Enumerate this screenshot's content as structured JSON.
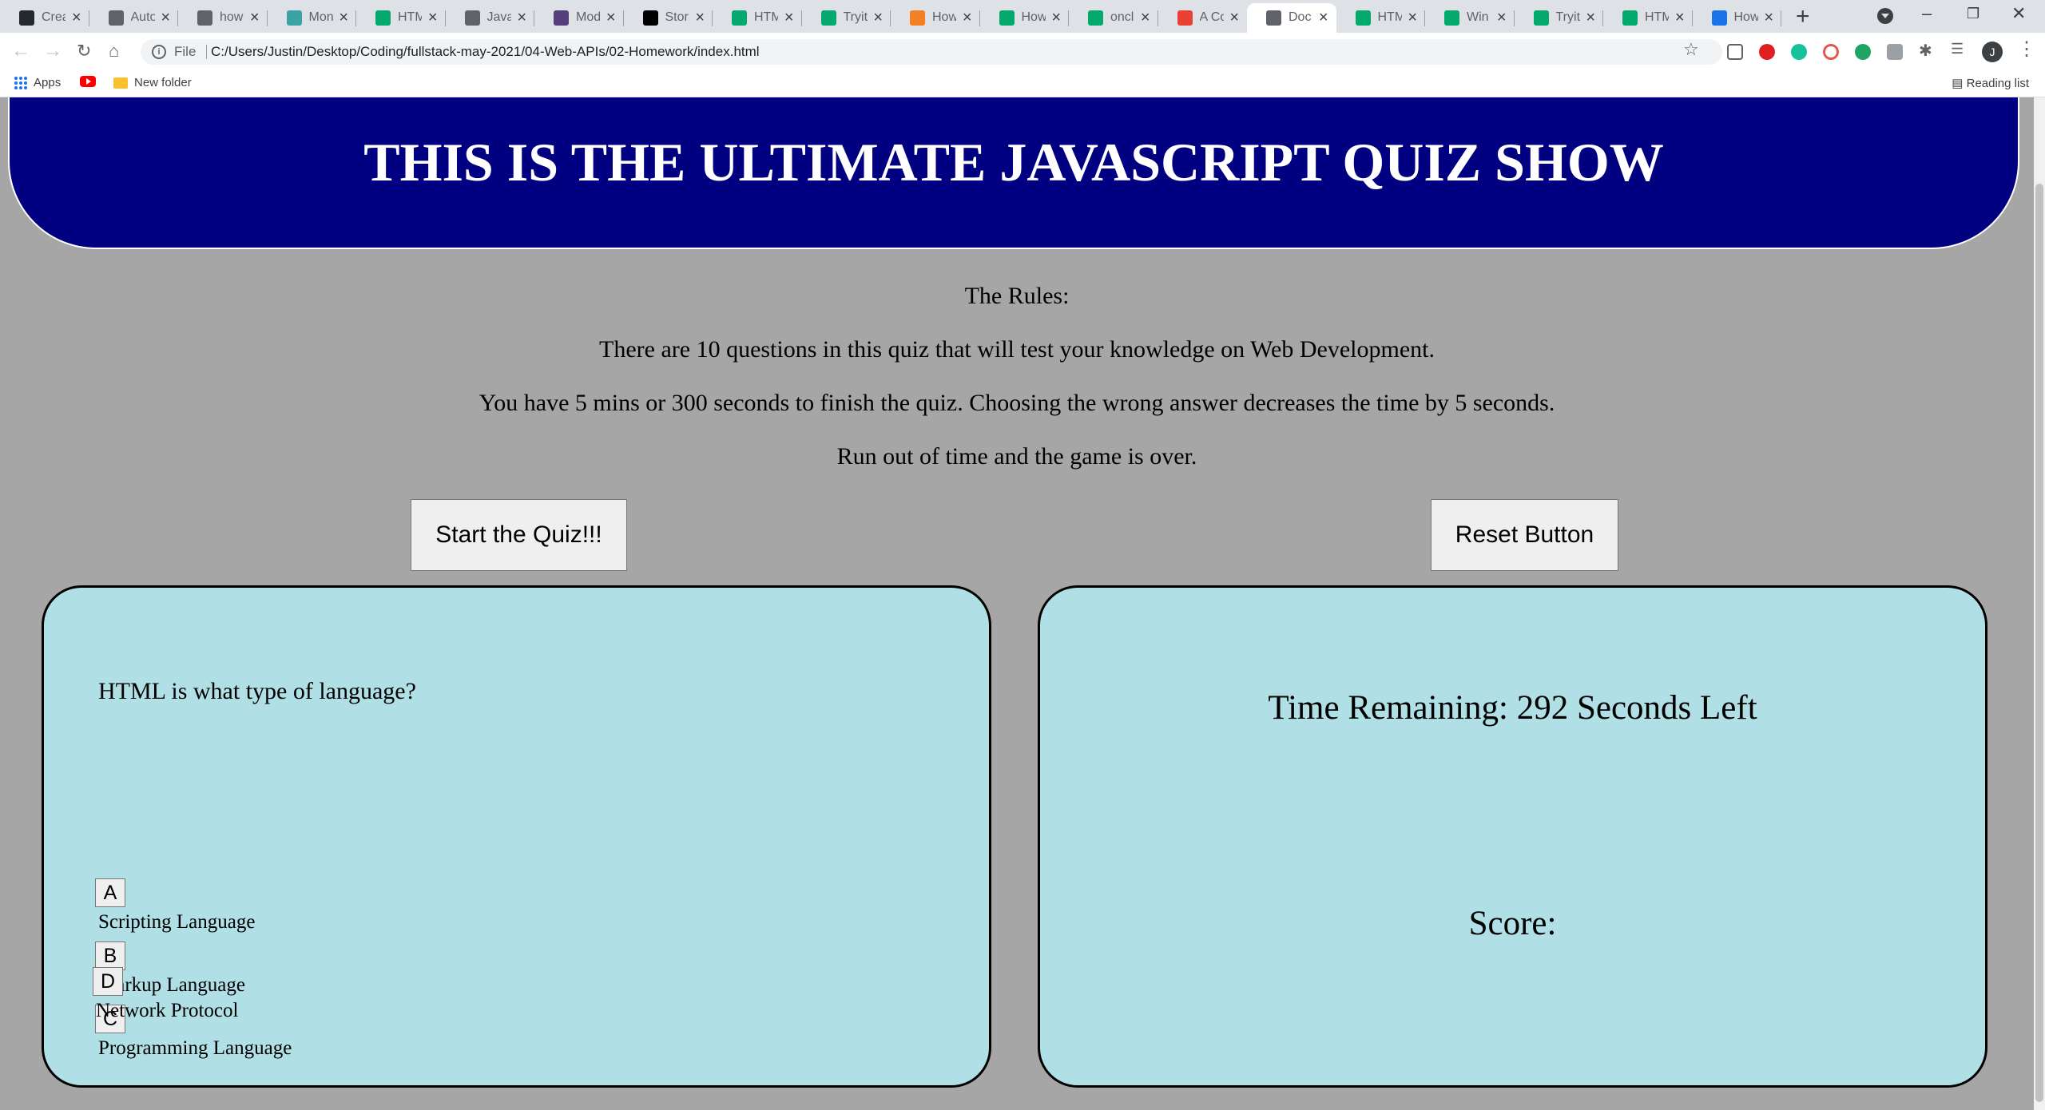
{
  "browser": {
    "tabs": [
      {
        "title": "Crea",
        "icon": "github-icon",
        "color": "#24292e"
      },
      {
        "title": "Auto",
        "icon": "globe-icon",
        "color": "#5f6368"
      },
      {
        "title": "how",
        "icon": "globe-icon",
        "color": "#5f6368"
      },
      {
        "title": "Mon",
        "icon": "clock-icon",
        "color": "#3aa3a3"
      },
      {
        "title": "HTM",
        "icon": "w3schools-icon",
        "color": "#04aa6d"
      },
      {
        "title": "Java",
        "icon": "globe-icon",
        "color": "#5f6368"
      },
      {
        "title": "Mod",
        "icon": "bootstrap-icon",
        "color": "#563d7c"
      },
      {
        "title": "Stor",
        "icon": "stackoverflow-icon",
        "color": "#000000"
      },
      {
        "title": "HTM",
        "icon": "w3schools-icon",
        "color": "#04aa6d"
      },
      {
        "title": "Tryit",
        "icon": "w3schools-icon",
        "color": "#04aa6d"
      },
      {
        "title": "How",
        "icon": "pencil-icon",
        "color": "#f48024"
      },
      {
        "title": "How",
        "icon": "w3schools-icon",
        "color": "#04aa6d"
      },
      {
        "title": "oncl",
        "icon": "w3schools-icon",
        "color": "#04aa6d"
      },
      {
        "title": "A Co",
        "icon": "asterisk-icon",
        "color": "#e94235"
      },
      {
        "title": "Doc",
        "icon": "globe-icon",
        "color": "#5f6368",
        "active": true
      },
      {
        "title": "HTM",
        "icon": "w3schools-icon",
        "color": "#04aa6d"
      },
      {
        "title": "Win",
        "icon": "w3schools-icon",
        "color": "#04aa6d"
      },
      {
        "title": "Tryit",
        "icon": "w3schools-icon",
        "color": "#04aa6d"
      },
      {
        "title": "HTM",
        "icon": "w3schools-icon",
        "color": "#04aa6d"
      },
      {
        "title": "How",
        "icon": "refresh-blue-icon",
        "color": "#1a73e8"
      }
    ],
    "file_label": "File",
    "url": "C:/Users/Justin/Desktop/Coding/fullstack-may-2021/04-Web-APIs/02-Homework/index.html",
    "avatar_letter": "J",
    "bookmarks": {
      "apps": "Apps",
      "folder": "New folder",
      "reading_list": "Reading list"
    }
  },
  "page": {
    "banner_title": "THIS IS THE ULTIMATE JAVASCRIPT QUIZ SHOW",
    "rules": [
      "The Rules:",
      "There are 10 questions in this quiz that will test your knowledge on Web Development.",
      "You have 5 mins or 300 seconds to finish the quiz. Choosing the wrong answer decreases the time by 5 seconds.",
      "Run out of time and the game is over."
    ],
    "start_button": "Start the Quiz!!!",
    "reset_button": "Reset Button",
    "quiz": {
      "question": "HTML is what type of language?",
      "options": [
        {
          "letter": "A",
          "text": "Scripting Language"
        },
        {
          "letter": "B",
          "text": "Markup Language"
        },
        {
          "letter": "C",
          "text": "Programming Language"
        },
        {
          "letter": "D",
          "text": "Network Protocol"
        }
      ]
    },
    "status": {
      "timer": "Time Remaining: 292 Seconds Left",
      "score": "Score:"
    },
    "colors": {
      "background": "#a6a6a6",
      "banner": "#000080",
      "card": "#b0dfe5"
    }
  }
}
